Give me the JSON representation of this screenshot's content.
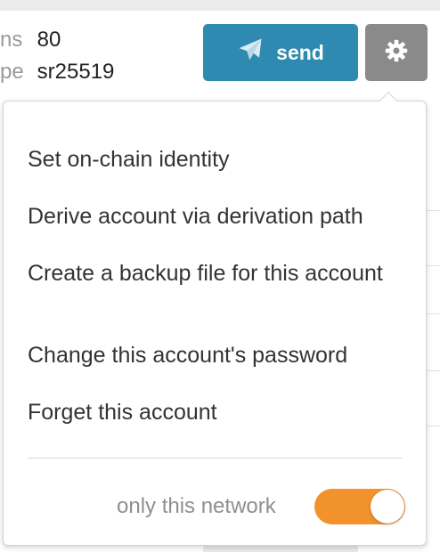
{
  "account": {
    "row1_label": "ns",
    "row1_value": "80",
    "row2_label": "pe",
    "row2_value": "sr25519"
  },
  "toolbar": {
    "send_label": "send",
    "send_icon": "paper-plane-icon",
    "settings_icon": "gear-icon"
  },
  "menu": {
    "items": [
      {
        "label": "Set on-chain identity"
      },
      {
        "label": "Derive account via derivation path"
      },
      {
        "label": "Create a backup file for this account"
      },
      {
        "label": "Change this account's password"
      },
      {
        "label": "Forget this account"
      }
    ],
    "toggle": {
      "label": "only this network",
      "on": true,
      "color": "#f2922c"
    }
  },
  "colors": {
    "send_button": "#2e8ab0",
    "gear_button": "#8a8a8a"
  }
}
